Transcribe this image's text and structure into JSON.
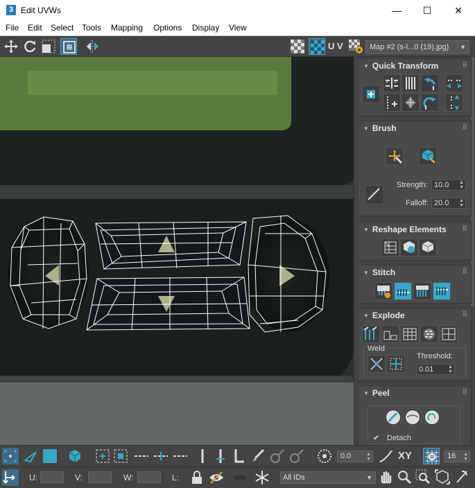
{
  "window": {
    "title": "Edit UVWs",
    "app_icon": "3"
  },
  "window_controls": {
    "minimize": "—",
    "maximize": "☐",
    "close": "✕"
  },
  "menu": [
    "File",
    "Edit",
    "Select",
    "Tools",
    "Mapping",
    "Options",
    "Display",
    "View"
  ],
  "toolbar": {
    "uv_label": "U V",
    "map_select": "Map #2 (s-l...0 (19).jpg)"
  },
  "panel": {
    "quick_transform": {
      "title": "Quick Transform"
    },
    "brush": {
      "title": "Brush",
      "strength_label": "Strength:",
      "strength_value": "10.0",
      "falloff_label": "Falloff:",
      "falloff_value": "20.0"
    },
    "reshape": {
      "title": "Reshape Elements"
    },
    "stitch": {
      "title": "Stitch"
    },
    "explode": {
      "title": "Explode",
      "weld_label": "Weld",
      "threshold_label": "Threshold:",
      "threshold_value": "0.01"
    },
    "peel": {
      "title": "Peel",
      "detach_label": "Detach",
      "detach_checked": true
    }
  },
  "bottom_bar": {
    "offset_value": "0.0",
    "xy_label": "XY",
    "grid_value": "16"
  },
  "status_bar": {
    "u_label": "U:",
    "v_label": "V:",
    "w_label": "W:",
    "l_label": "L:",
    "ids_select": "All IDs"
  },
  "colors": {
    "accent": "#3aa7c8",
    "panel_bg": "#444444",
    "wire": "#ffffff"
  }
}
